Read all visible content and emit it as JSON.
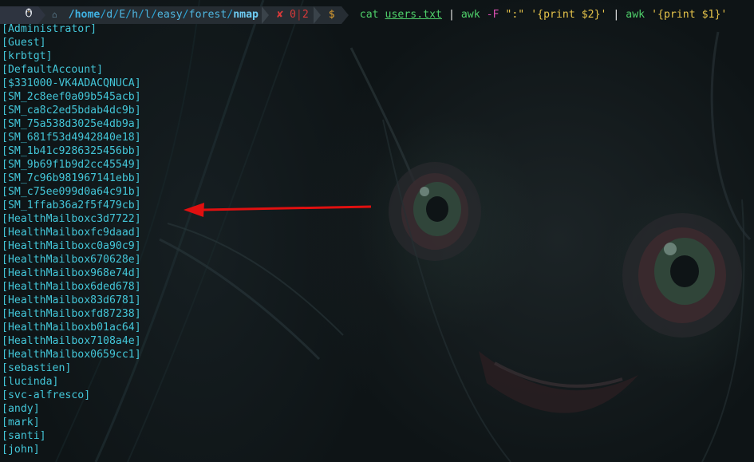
{
  "prompt": {
    "os_icon": "linux-penguin-icon",
    "folder_icon": "folder-icon",
    "path": {
      "root": "/home",
      "parts": [
        "d",
        "E",
        "h",
        "l",
        "easy",
        "forest"
      ],
      "last": "nmap"
    },
    "status": {
      "error_icon": "✘",
      "code": "0",
      "separator": "|",
      "jobs": "2"
    },
    "symbol": "$"
  },
  "command": {
    "cmd1": "cat",
    "file": "users.txt",
    "pipe1": " | ",
    "cmd2": "awk",
    "opt": " -F ",
    "delim": "\":\"",
    "prog1": " '{print $2}'",
    "pipe2": " | ",
    "cmd3": "awk",
    "prog2": " '{print $1}'"
  },
  "output_lines": [
    "[Administrator]",
    "[Guest]",
    "[krbtgt]",
    "[DefaultAccount]",
    "[$331000-VK4ADACQNUCA]",
    "[SM_2c8eef0a09b545acb]",
    "[SM_ca8c2ed5bdab4dc9b]",
    "[SM_75a538d3025e4db9a]",
    "[SM_681f53d4942840e18]",
    "[SM_1b41c9286325456bb]",
    "[SM_9b69f1b9d2cc45549]",
    "[SM_7c96b981967141ebb]",
    "[SM_c75ee099d0a64c91b]",
    "[SM_1ffab36a2f5f479cb]",
    "[HealthMailboxc3d7722]",
    "[HealthMailboxfc9daad]",
    "[HealthMailboxc0a90c9]",
    "[HealthMailbox670628e]",
    "[HealthMailbox968e74d]",
    "[HealthMailbox6ded678]",
    "[HealthMailbox83d6781]",
    "[HealthMailboxfd87238]",
    "[HealthMailboxb01ac64]",
    "[HealthMailbox7108a4e]",
    "[HealthMailbox0659cc1]",
    "[sebastien]",
    "[lucinda]",
    "[svc-alfresco]",
    "[andy]",
    "[mark]",
    "[santi]",
    "[john]"
  ],
  "colors": {
    "output_text": "#43c6d8",
    "annotation_arrow": "#e01010",
    "background": "#0e1416"
  }
}
